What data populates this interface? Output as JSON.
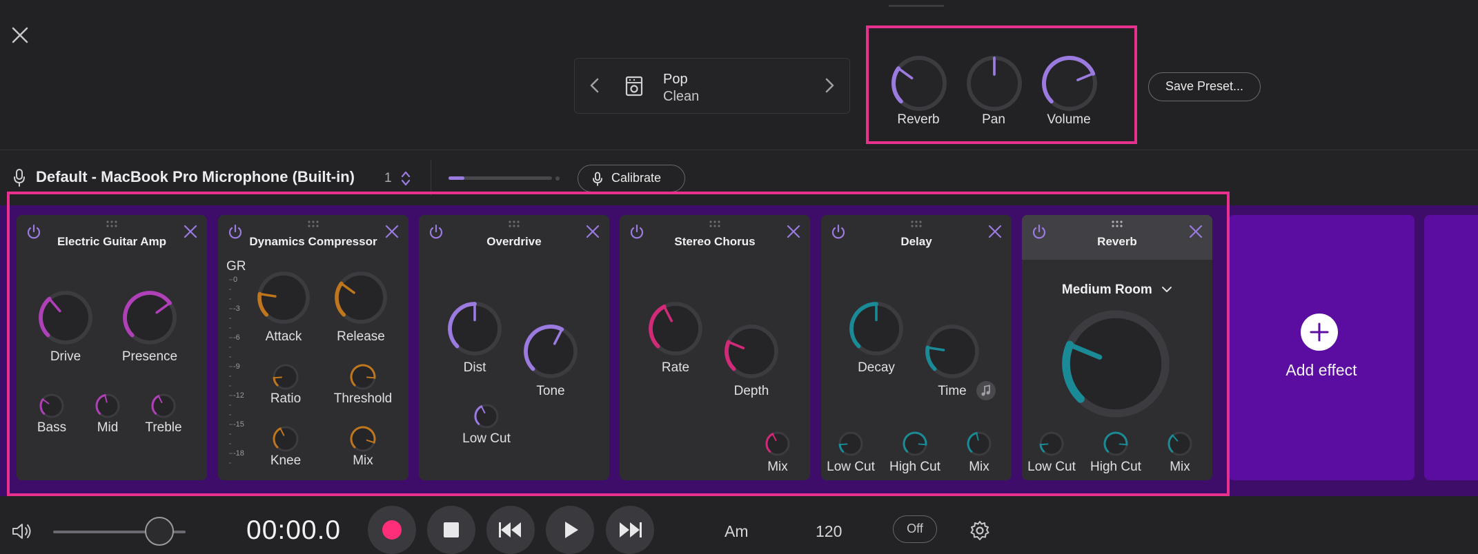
{
  "header": {
    "close_icon": "close-icon",
    "preset": {
      "name": "Pop",
      "sub": "Clean",
      "prev_icon": "chevron-left-icon",
      "next_icon": "chevron-right-icon",
      "type_icon": "amp-icon"
    },
    "master_knobs": [
      {
        "label": "Reverb",
        "value": 0.3
      },
      {
        "label": "Pan",
        "value": 0.5
      },
      {
        "label": "Volume",
        "value": 0.75
      }
    ],
    "save_label": "Save Preset..."
  },
  "input": {
    "device_name": "Default - MacBook Pro Microphone (Built-in)",
    "channel": "1",
    "level": 0.15,
    "calibrate_label": "Calibrate"
  },
  "colors": {
    "accent_purple": "#9b7be0",
    "magenta": "#b040b8",
    "orange": "#c0761c",
    "pink": "#d02a78",
    "teal": "#1a8a96",
    "rack_bg": "#3e0d6a",
    "add_bg": "#5a0da0",
    "highlight": "#e8308e",
    "record": "#ff2e7a"
  },
  "effects": [
    {
      "title": "Electric Guitar Amp",
      "knobs": [
        {
          "label": "Drive",
          "value": 0.35
        },
        {
          "label": "Presence",
          "value": 0.7
        },
        {
          "label": "Bass",
          "value": 0.3
        },
        {
          "label": "Mid",
          "value": 0.45
        },
        {
          "label": "Treble",
          "value": 0.4
        }
      ]
    },
    {
      "title": "Dynamics Compressor",
      "gr_label": "GR",
      "gr_ticks": [
        "0",
        "-3",
        "-6",
        "-9",
        "-12",
        "-15",
        "-18"
      ],
      "knobs": [
        {
          "label": "Attack",
          "value": 0.2
        },
        {
          "label": "Release",
          "value": 0.3
        },
        {
          "label": "Ratio",
          "value": 0.15
        },
        {
          "label": "Threshold",
          "value": 0.85
        },
        {
          "label": "Knee",
          "value": 0.4
        },
        {
          "label": "Mix",
          "value": 0.9
        }
      ]
    },
    {
      "title": "Overdrive",
      "knobs": [
        {
          "label": "Dist",
          "value": 0.5
        },
        {
          "label": "Tone",
          "value": 0.6
        },
        {
          "label": "Low Cut",
          "value": 0.4
        }
      ]
    },
    {
      "title": "Stereo Chorus",
      "knobs": [
        {
          "label": "Rate",
          "value": 0.4
        },
        {
          "label": "Depth",
          "value": 0.25
        },
        {
          "label": "Mix",
          "value": 0.4
        }
      ]
    },
    {
      "title": "Delay",
      "knobs": [
        {
          "label": "Decay",
          "value": 0.5
        },
        {
          "label": "Time",
          "value": 0.2
        },
        {
          "label": "Low Cut",
          "value": 0.15
        },
        {
          "label": "High Cut",
          "value": 0.85
        },
        {
          "label": "Mix",
          "value": 0.45
        }
      ]
    },
    {
      "title": "Reverb",
      "room": "Medium Room",
      "knobs": [
        {
          "label": "",
          "value": 0.25
        },
        {
          "label": "Low Cut",
          "value": 0.15
        },
        {
          "label": "High Cut",
          "value": 0.85
        },
        {
          "label": "Mix",
          "value": 0.35
        }
      ]
    }
  ],
  "add_effect_label": "Add effect",
  "transport": {
    "volume": 0.8,
    "time": "00:00.0",
    "key": "Am",
    "bpm": "120",
    "metronome": "Off"
  }
}
